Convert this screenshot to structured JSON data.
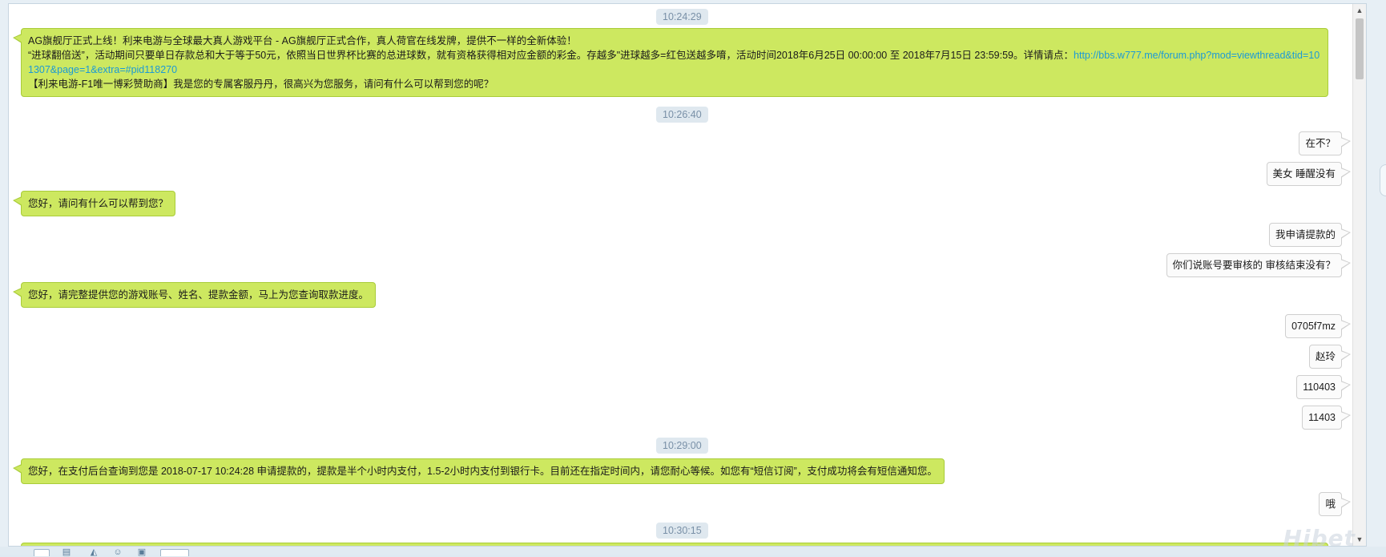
{
  "timestamps": [
    "10:24:29",
    "10:26:40",
    "10:29:00",
    "10:30:15"
  ],
  "messages": {
    "welcome": {
      "line1": "AG旗舰厅正式上线！利来电游与全球最大真人游戏平台 - AG旗舰厅正式合作，真人荷官在线发牌，提供不一样的全新体验！",
      "line2": "“进球翻倍送”，活动期间只要单日存款总和大于等于50元，依照当日世界杯比赛的总进球数，就有资格获得相对应金额的彩金。存越多\"进球越多=红包送越多唷，活动时间2018年6月25日 00:00:00 至 2018年7月15日 23:59:59。详情请点：",
      "link_part1": "http://bbs.w777.me/forum.php?mod=viewthread&tid=10",
      "link_part2": "1307&page=1&extra=#pid118270",
      "line3": "【利来电游-F1唯一博彩赞助商】我是您的专属客服丹丹，很高兴为您服务，请问有什么可以帮到您的呢？"
    },
    "out1": "在不？",
    "out2": "美女 睡醒没有",
    "in1": "您好，请问有什么可以帮到您？",
    "out3": "我申请提款的",
    "out4": "你们说账号要审核的 审核结束没有？",
    "in2": "您好，请完整提供您的游戏账号、姓名、提款金额，马上为您查询取款进度。",
    "out5": "0705f7mz",
    "out6": "赵玲",
    "out7": "110403",
    "out8": "11403",
    "in3": "您好，在支付后台查询到您是 2018-07-17 10:24:28 申请提款的，提款是半个小时内支付，1.5-2小时内支付到银行卡。目前还在指定时间内，请您耐心等候。如您有“短信订阅”，支付成功将会有短信通知您。",
    "out9": "哦"
  },
  "watermark": "Hibet",
  "colors": {
    "incoming": "#cde860",
    "outgoing": "#fbfbfb",
    "link": "#1c9ad6",
    "timestamp_text": "#7990a7"
  }
}
